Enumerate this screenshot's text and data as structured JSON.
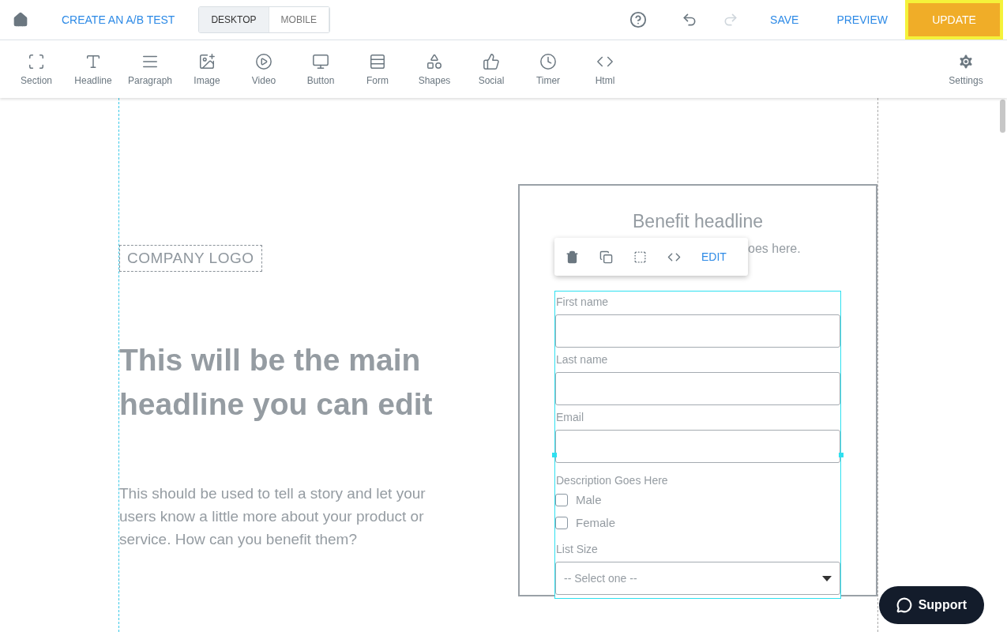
{
  "top_bar": {
    "ab_test_link": "CREATE AN A/B TEST",
    "view_tabs": [
      {
        "label": "DESKTOP",
        "selected": true
      },
      {
        "label": "MOBILE",
        "selected": false
      }
    ],
    "actions": {
      "save": "SAVE",
      "preview": "PREVIEW",
      "update": "UPDATE"
    },
    "redo_disabled": true
  },
  "toolbar": {
    "items": [
      "Section",
      "Headline",
      "Paragraph",
      "Image",
      "Video",
      "Button",
      "Form",
      "Shapes",
      "Social",
      "Timer",
      "Html"
    ],
    "settings": "Settings"
  },
  "canvas": {
    "logo": "COMPANY LOGO",
    "headline": "This will be the main headline you can edit",
    "body": "This should be used to tell a story and let your users know a little more about your product or service. How can you benefit them?",
    "card": {
      "title": "Benefit headline",
      "subtitle_visible_part": "oes here.",
      "element_toolbar": {
        "edit": "EDIT"
      },
      "form": [
        {
          "kind": "text",
          "label": "First name"
        },
        {
          "kind": "text",
          "label": "Last name"
        },
        {
          "kind": "text",
          "label": "Email"
        },
        {
          "kind": "checkgroup",
          "label": "Description Goes Here",
          "options": [
            {
              "label": "Male",
              "checked": false
            },
            {
              "label": "Female",
              "checked": false
            }
          ]
        },
        {
          "kind": "select",
          "label": "List Size",
          "placeholder": "-- Select one --"
        }
      ]
    }
  },
  "support_button": "Support"
}
